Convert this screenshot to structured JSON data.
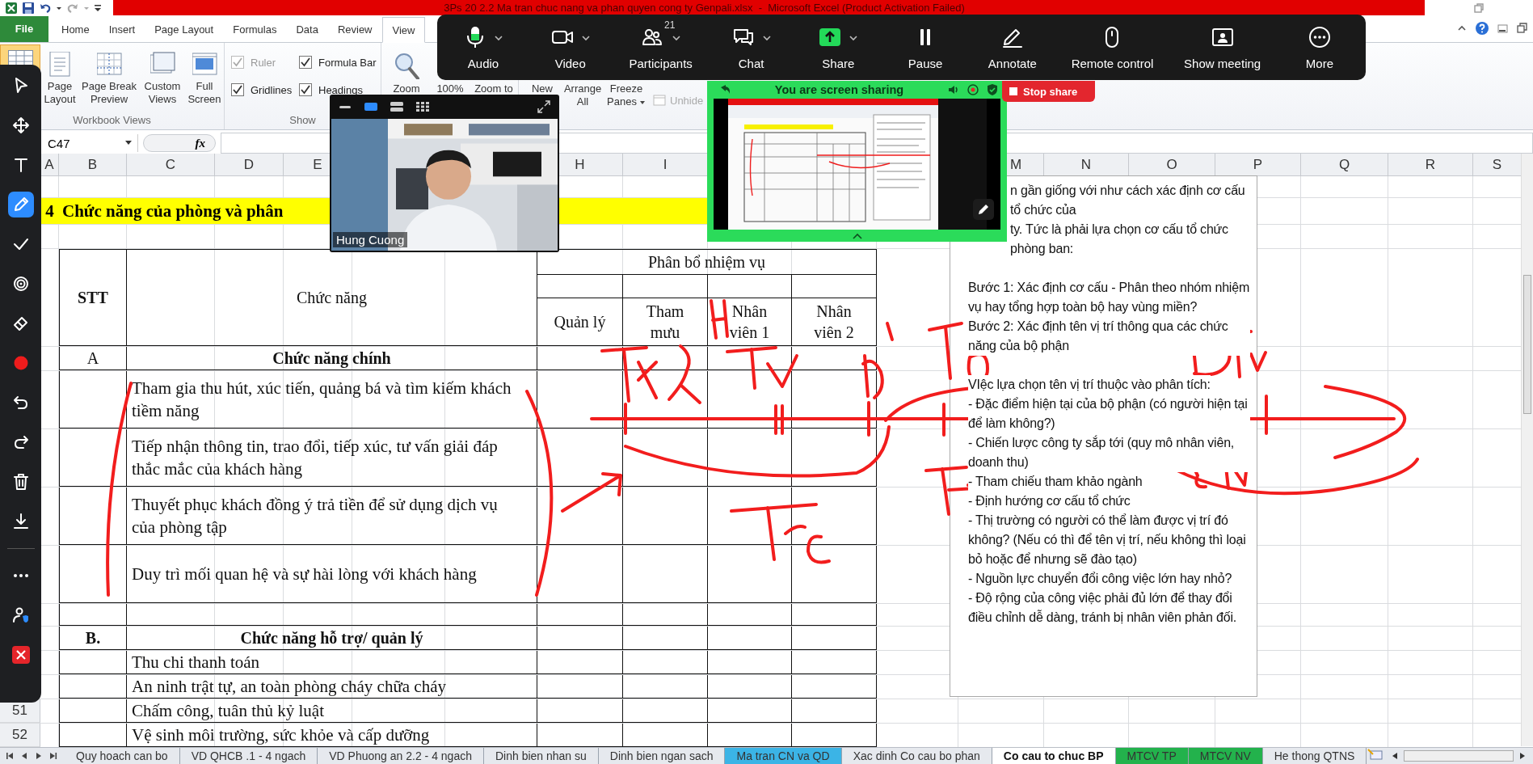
{
  "title_bar": {
    "title": "3Ps 20 2.2 Ma tran chuc nang va phan quyen cong ty Genpali.xlsx  -  Microsoft Excel (Product Activation Failed)"
  },
  "ribbon": {
    "tabs": [
      {
        "label": "File",
        "kind": "file",
        "selected": false
      },
      {
        "label": "Home",
        "kind": "tab",
        "selected": false
      },
      {
        "label": "Insert",
        "kind": "tab",
        "selected": false
      },
      {
        "label": "Page Layout",
        "kind": "tab",
        "selected": false
      },
      {
        "label": "Formulas",
        "kind": "tab",
        "selected": false
      },
      {
        "label": "Data",
        "kind": "tab",
        "selected": false
      },
      {
        "label": "Review",
        "kind": "tab",
        "selected": false
      },
      {
        "label": "View",
        "kind": "tab",
        "selected": true
      }
    ],
    "workbook_views": {
      "title": "Workbook Views",
      "buttons": [
        {
          "selected": true
        },
        {
          "label": "Page Layout",
          "selected": false
        },
        {
          "label": "Page Break Preview",
          "selected": false
        },
        {
          "label": "Custom Views",
          "selected": false
        },
        {
          "label": "Full Screen",
          "selected": false
        }
      ]
    },
    "show": {
      "title": "Show",
      "checkboxes": [
        {
          "label": "Ruler",
          "checked": true,
          "disabled": true
        },
        {
          "label": "Formula Bar",
          "checked": true,
          "disabled": false
        },
        {
          "label": "Gridlines",
          "checked": true,
          "disabled": false
        },
        {
          "label": "Headings",
          "checked": true,
          "disabled": false
        }
      ]
    },
    "zoom": {
      "buttons": [
        {
          "label": "Zoom"
        },
        {
          "label": "100%"
        },
        {
          "label": "Zoom to"
        }
      ]
    },
    "window": {
      "buttons": [
        {
          "label": "New",
          "has_menu": false
        },
        {
          "label": "Arrange All",
          "has_menu": false
        },
        {
          "label": "Freeze Panes",
          "has_menu": true
        }
      ],
      "unhide": {
        "label": "Unhide",
        "disabled": true
      }
    }
  },
  "formula_bar": {
    "name_box": "C47",
    "function_button": "fx"
  },
  "sheet": {
    "column_headers": [
      "A",
      "B",
      "C",
      "D",
      "E",
      "H",
      "I",
      "M",
      "N",
      "O",
      "P",
      "Q",
      "R",
      "S"
    ],
    "section_title": {
      "number": "4",
      "text": "Chức năng của phòng và phân"
    },
    "table": {
      "stt_header": "STT",
      "function_header": "Chức năng",
      "group_header": "Phân bổ nhiệm vụ",
      "roles": [
        "Quản lý",
        "Tham mưu",
        "Nhân viên 1",
        "Nhân viên 2"
      ],
      "sections": [
        {
          "stt": "A",
          "title": "Chức năng chính",
          "items": [
            {
              "text": "Tham gia thu hút, xúc tiến, quảng bá và tìm kiếm khách tiềm năng"
            },
            {
              "text": "Tiếp nhận thông tin, trao đổi, tiếp xúc, tư vấn giải đáp thắc mắc của khách hàng"
            },
            {
              "text": "Thuyết phục khách đồng ý trả tiền để sử dụng dịch vụ của phòng tập"
            },
            {
              "text": "Duy trì mối quan hệ và sự hài lòng với khách hàng"
            }
          ]
        },
        {
          "stt": "B.",
          "title": "Chức năng hỗ trợ/ quản lý",
          "items": [
            {
              "text": "Thu chi thanh toán"
            },
            {
              "text": "An ninh trật tự, an toàn phòng cháy chữa cháy"
            },
            {
              "text": "Chấm công, tuân thủ kỷ luật",
              "row_number": "51"
            },
            {
              "text": "Vệ sinh môi trường, sức khỏe và cấp dưỡng",
              "row_number": "52"
            }
          ]
        }
      ]
    },
    "text_box": {
      "blocks": [
        [
          "n gần giống với như cách xác định cơ cấu tổ chức của",
          "ty. Tức là phải lựa chọn cơ cấu tổ chức phòng ban:"
        ],
        [
          "Bước 1: Xác định cơ cấu - Phân theo nhóm nhiệm vụ hay tổng hợp toàn bộ hay vùng miền?",
          "Bước 2: Xác định tên vị trí thông qua các chức năng của bộ phận"
        ],
        [
          "VIệc lựa chọn tên vị trí thuộc vào phân tích:",
          "- Đặc điểm hiện tại của bộ phận (có người hiện tại để làm không?)",
          "- Chiến lược  công ty sắp tới (quy mô nhân viên, doanh thu)",
          "- Tham chiếu tham khảo ngành",
          "- Định hướng cơ cấu tổ chức",
          "- Thị trường có người có thể làm được vị trí đó không? (Nếu có thì để tên vị trí, nếu không thì loại bỏ hoặc để nhưng sẽ đào tạo)",
          "- Nguồn lực chuyển đổi công việc lớn hay nhỏ?",
          "- Độ rộng của công việc phải đủ lớn để thay đổi điều chỉnh dễ dàng, tránh bị nhân viên phản đối."
        ]
      ]
    }
  },
  "sheet_tabs": [
    {
      "label": "Quy hoach can bo",
      "selected": false
    },
    {
      "label": "VD QHCB .1 - 4 ngach",
      "selected": false
    },
    {
      "label": "VD Phuong an 2.2 - 4 ngach",
      "selected": false
    },
    {
      "label": "Dinh bien nhan su",
      "selected": false
    },
    {
      "label": "Dinh bien ngan sach",
      "selected": false
    },
    {
      "label": "Ma tran CN va QD",
      "selected": false,
      "color": "#3bb4e6"
    },
    {
      "label": "Xac dinh Co cau bo phan",
      "selected": false
    },
    {
      "label": "Co cau to chuc BP",
      "selected": true
    },
    {
      "label": "MTCV TP",
      "selected": false,
      "color": "#23b24c"
    },
    {
      "label": "MTCV NV",
      "selected": false,
      "color": "#23b24c"
    },
    {
      "label": "He thong QTNS",
      "selected": false
    }
  ],
  "meeting_toolbar": {
    "items": [
      {
        "label": "Audio",
        "has_menu": true,
        "muted": false
      },
      {
        "label": "Video",
        "has_menu": true
      },
      {
        "label": "Participants",
        "has_menu": true,
        "badge": "21"
      },
      {
        "label": "Chat",
        "has_menu": true
      },
      {
        "label": "Share",
        "has_menu": true
      },
      {
        "label": "Pause",
        "has_menu": false
      },
      {
        "label": "Annotate",
        "has_menu": false
      },
      {
        "label": "Remote control",
        "has_menu": false
      },
      {
        "label": "Show meeting",
        "has_menu": false
      },
      {
        "label": "More",
        "has_menu": false
      }
    ]
  },
  "sharing_panel": {
    "status": "You are screen sharing",
    "stop_button": "Stop share"
  },
  "video_tile": {
    "name": "Hung Cuong"
  },
  "annotation_toolbar": {
    "tools": [
      {
        "selected": false
      },
      {
        "selected": false
      },
      {
        "selected": false
      },
      {
        "selected": true
      },
      {
        "selected": false
      },
      {
        "selected": false
      },
      {
        "selected": false
      },
      {
        "selected": false,
        "color": "#ee1c1c"
      },
      {
        "selected": false
      },
      {
        "selected": false
      },
      {
        "selected": false
      },
      {
        "selected": false
      },
      {
        "selected": false
      },
      {
        "selected": false
      },
      {
        "selected": false
      }
    ]
  }
}
